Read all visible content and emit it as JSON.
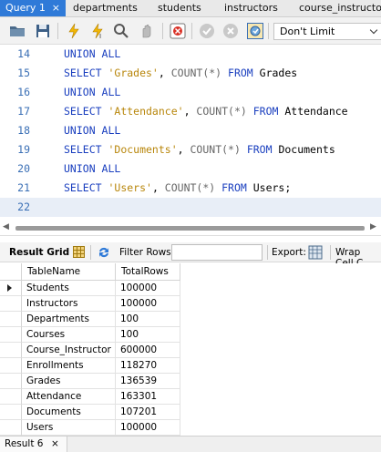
{
  "tabs": [
    {
      "label": "Query 1",
      "active": true
    },
    {
      "label": "departments"
    },
    {
      "label": "students"
    },
    {
      "label": "instructors"
    },
    {
      "label": "course_instructor"
    }
  ],
  "tab_close_glyph": "×",
  "toolbar": {
    "icons": [
      "open-folder-icon",
      "save-icon",
      "execute-icon",
      "execute-current-icon",
      "find-icon",
      "stop-icon",
      "toggle-error-icon",
      "commit-icon",
      "rollback-icon",
      "autocommit-icon"
    ],
    "limit_value": "Don't Limit"
  },
  "editor": {
    "lines": [
      {
        "num": "14",
        "tokens": [
          {
            "t": "UNION ALL",
            "c": "kw"
          }
        ]
      },
      {
        "num": "15",
        "tokens": [
          {
            "t": "SELECT ",
            "c": "kw"
          },
          {
            "t": "'Grades'",
            "c": "str"
          },
          {
            "t": ", ",
            "c": ""
          },
          {
            "t": "COUNT(*)",
            "c": "fn"
          },
          {
            "t": " FROM ",
            "c": "kw"
          },
          {
            "t": "Grades",
            "c": ""
          }
        ]
      },
      {
        "num": "16",
        "tokens": [
          {
            "t": "UNION ALL",
            "c": "kw"
          }
        ]
      },
      {
        "num": "17",
        "tokens": [
          {
            "t": "SELECT ",
            "c": "kw"
          },
          {
            "t": "'Attendance'",
            "c": "str"
          },
          {
            "t": ", ",
            "c": ""
          },
          {
            "t": "COUNT(*)",
            "c": "fn"
          },
          {
            "t": " FROM ",
            "c": "kw"
          },
          {
            "t": "Attendance",
            "c": ""
          }
        ]
      },
      {
        "num": "18",
        "tokens": [
          {
            "t": "UNION ALL",
            "c": "kw"
          }
        ]
      },
      {
        "num": "19",
        "tokens": [
          {
            "t": "SELECT ",
            "c": "kw"
          },
          {
            "t": "'Documents'",
            "c": "str"
          },
          {
            "t": ", ",
            "c": ""
          },
          {
            "t": "COUNT(*)",
            "c": "fn"
          },
          {
            "t": " FROM ",
            "c": "kw"
          },
          {
            "t": "Documents",
            "c": ""
          }
        ]
      },
      {
        "num": "20",
        "tokens": [
          {
            "t": "UNION ALL",
            "c": "kw"
          }
        ]
      },
      {
        "num": "21",
        "tokens": [
          {
            "t": "SELECT ",
            "c": "kw"
          },
          {
            "t": "'Users'",
            "c": "str"
          },
          {
            "t": ", ",
            "c": ""
          },
          {
            "t": "COUNT(*)",
            "c": "fn"
          },
          {
            "t": " FROM ",
            "c": "kw"
          },
          {
            "t": "Users;",
            "c": ""
          }
        ]
      },
      {
        "num": "22",
        "tokens": [],
        "current": true
      }
    ]
  },
  "result_toolbar": {
    "result_grid_label": "Result Grid",
    "filter_label": "Filter Rows:",
    "filter_value": "",
    "export_label": "Export:",
    "wrap_label": "Wrap Cell C"
  },
  "grid": {
    "columns": [
      "TableName",
      "TotalRows"
    ],
    "rows": [
      [
        "Students",
        "100000"
      ],
      [
        "Instructors",
        "100000"
      ],
      [
        "Departments",
        "100"
      ],
      [
        "Courses",
        "100"
      ],
      [
        "Course_Instructor",
        "600000"
      ],
      [
        "Enrollments",
        "118270"
      ],
      [
        "Grades",
        "136539"
      ],
      [
        "Attendance",
        "163301"
      ],
      [
        "Documents",
        "107201"
      ],
      [
        "Users",
        "100000"
      ]
    ],
    "selected_row": 0
  },
  "bottom_tab": {
    "label": "Result 6",
    "close": "×"
  },
  "colors": {
    "accent": "#2f7ad8",
    "keyword": "#1a3fbf",
    "string": "#b8860b",
    "line_number": "#3a6fb5"
  }
}
